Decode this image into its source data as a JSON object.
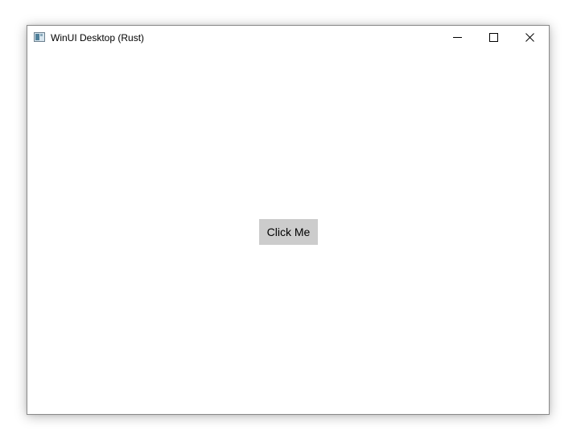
{
  "window": {
    "title": "WinUI Desktop (Rust)",
    "icon": "app-window-icon",
    "controls": {
      "minimize_icon": "minimize-icon",
      "maximize_icon": "maximize-icon",
      "close_icon": "close-icon"
    }
  },
  "content": {
    "button_label": "Click Me"
  },
  "colors": {
    "window_background": "#ffffff",
    "button_background": "#cccccc",
    "border": "#8a8a8a"
  }
}
